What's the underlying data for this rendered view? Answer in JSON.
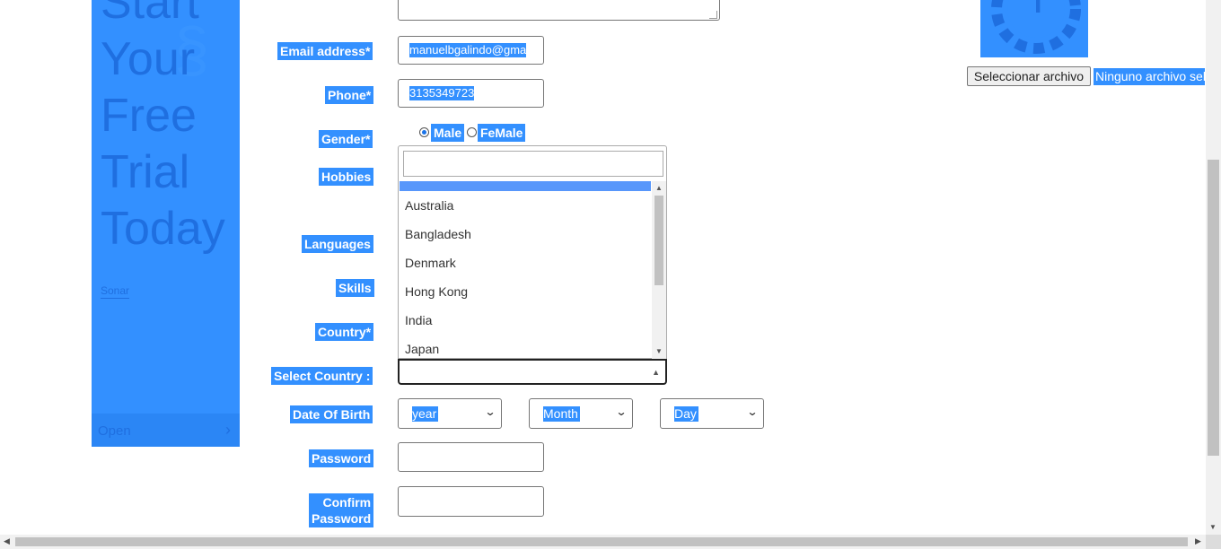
{
  "ad": {
    "headline_lines": [
      "Start",
      "Your",
      "Free",
      "Trial",
      "Today"
    ],
    "link_text": "Sonar",
    "open_label": "Open"
  },
  "form": {
    "email_label": "Email address*",
    "email_value": "manuelbgalindo@gma",
    "phone_label": "Phone*",
    "phone_value": "3135349723",
    "gender_label": "Gender*",
    "gender_options": [
      "Male",
      "FeMale"
    ],
    "gender_selected": "Male",
    "hobbies_label": "Hobbies",
    "languages_label": "Languages",
    "skills_label": "Skills",
    "country_label": "Country*",
    "select_country_label": "Select Country :",
    "country_search_value": "",
    "country_options": [
      "Australia",
      "Bangladesh",
      "Denmark",
      "Hong Kong",
      "India",
      "Japan"
    ],
    "dob_label": "Date Of Birth",
    "dob_year": "year",
    "dob_month": "Month",
    "dob_day": "Day",
    "password_label": "Password",
    "confirm_password_label_lines": [
      "Confirm",
      "Password"
    ]
  },
  "upload": {
    "button_label": "Seleccionar archivo",
    "status_text": "Ninguno archivo seleccionado"
  },
  "colors": {
    "selection_highlight": "#3390ff",
    "option_highlight": "#5897fb"
  }
}
